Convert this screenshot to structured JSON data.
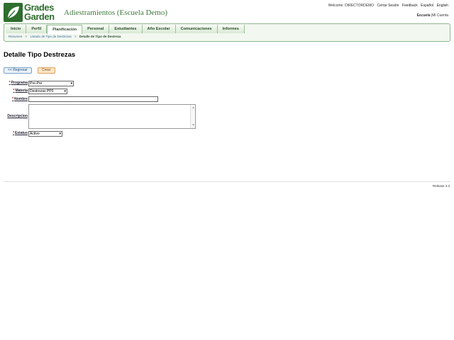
{
  "header": {
    "logo_line1": "Grades",
    "logo_line2": "Garden",
    "school_title": "Adiestramientos (Escuela Demo)",
    "welcome": "Welcome: DIRECTORDEMO",
    "logout": "Cerrar Sesión",
    "feedback": "Feedback",
    "lang_es": "Español",
    "lang_en": "English",
    "context_school": "Escuela",
    "context_sep": "|",
    "context_account": "Mi Cuenta"
  },
  "nav": {
    "items": [
      {
        "label": "Inicio"
      },
      {
        "label": "Perfil"
      },
      {
        "label": "Planificación"
      },
      {
        "label": "Personal"
      },
      {
        "label": "Estudiantes"
      },
      {
        "label": "Año Escolar"
      },
      {
        "label": "Comunicaciones"
      },
      {
        "label": "Informes"
      }
    ],
    "active_index": 2
  },
  "breadcrumb": {
    "items": [
      "Resumen",
      "Listado de Tipo de Destrezas",
      "Detalle de Tipo de Destreza"
    ],
    "sep": ">"
  },
  "page": {
    "title": "Detalle Tipo Destrezas",
    "back_label": "<< Regresar",
    "create_label": "Crear"
  },
  "form": {
    "required_mark": "*",
    "programa_label": "Programa",
    "programa_value": "Pre-Pre",
    "materia_label": "Materia",
    "materia_value": "Destrezas PP0",
    "nombre_label": "Nombre",
    "nombre_value": "",
    "descripcion_label": "Descripcion",
    "descripcion_value": "",
    "estatus_label": "Estatus",
    "estatus_value": "Activo"
  },
  "footer": {
    "release": "Release 3.3"
  },
  "colors": {
    "brand_green": "#2e6e2e",
    "nav_border": "#8fb88f",
    "required": "#cc0000"
  }
}
